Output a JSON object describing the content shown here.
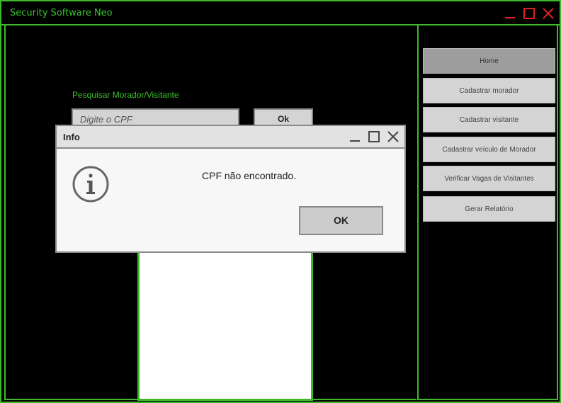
{
  "window": {
    "title": "Security Software Neo",
    "accent_color": "#3fb82c",
    "close_color": "#e02020",
    "controls": [
      "minimize-icon",
      "maximize-icon",
      "close-icon"
    ]
  },
  "search": {
    "label": "Pesquisar Morador/Visitante",
    "placeholder": "Digite o CPF",
    "button_label": "Ok"
  },
  "sidebar": {
    "items": [
      {
        "label": "Home",
        "active": true
      },
      {
        "label": "Cadastrar morador",
        "active": false
      },
      {
        "label": "Cadastrar visitante",
        "active": false
      },
      {
        "label": "Cadastrar veículo de Morador",
        "active": false
      },
      {
        "label": "Verificar Vagas de Visitantes",
        "active": false
      },
      {
        "label": "Gerar Relatório",
        "active": false
      }
    ]
  },
  "dialog": {
    "title": "Info",
    "icon": "info-icon",
    "message": "CPF não encontrado.",
    "ok_label": "OK"
  }
}
